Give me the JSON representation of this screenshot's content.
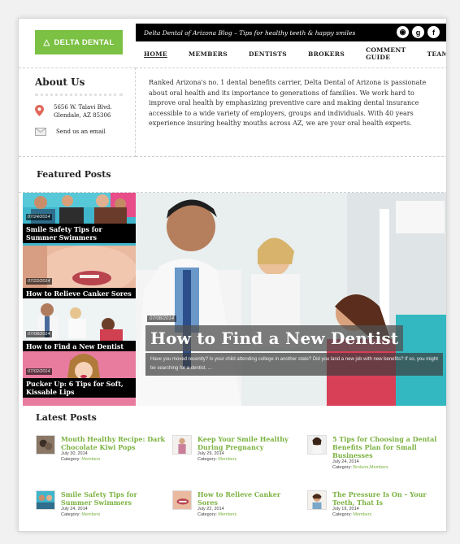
{
  "brand": {
    "logo_text": "DELTA DENTAL",
    "accent": "#7bc143"
  },
  "topbar": {
    "tagline": "Delta Dental of Arizona Blog – Tips for healthy teeth & happy smiles"
  },
  "social": [
    "rss-icon",
    "google-plus-icon",
    "facebook-icon"
  ],
  "nav": [
    "HOME",
    "MEMBERS",
    "DENTISTS",
    "BROKERS",
    "COMMENT GUIDE",
    "TEAM"
  ],
  "about": {
    "heading": "About Us",
    "address_line1": "5656 W. Talavi Blvd.",
    "address_line2": "Glendale, AZ 85306",
    "email_label": "Send us an email",
    "description": "Ranked Arizona's no. 1 dental benefits carrier, Delta Dental of Arizona is passionate about oral health and its importance to generations of families. We work hard to improve oral health by emphasizing preventive care and making dental insurance accessible to a wide variety of employers, groups and individuals. With 40 years experience insuring healthy mouths across AZ, we are your oral health experts."
  },
  "featured": {
    "heading": "Featured Posts",
    "items": [
      {
        "date": "07/24/2014",
        "title": "Smile Safety Tips for Summer Swimmers"
      },
      {
        "date": "07/22/2014",
        "title": "How to Relieve Canker Sores"
      },
      {
        "date": "07/08/2014",
        "title": "How to Find a New Dentist"
      },
      {
        "date": "07/02/2014",
        "title": "Pucker Up: 6 Tips for Soft, Kissable Lips"
      }
    ],
    "hero": {
      "date": "07/08/2014",
      "title": "How to Find a New Dentist",
      "excerpt": "Have you moved recently? Is your child attending college in another state? Did you land a new job with new benefits? If so, you might be searching for a dentist. ..."
    }
  },
  "latest": {
    "heading": "Latest Posts",
    "posts": [
      {
        "title": "Mouth Healthy Recipe: Dark Chocolate Kiwi Pops",
        "date": "July 30, 2014",
        "category_label": "Category:",
        "category": "Members"
      },
      {
        "title": "Keep Your Smile Healthy During Pregnancy",
        "date": "July 29, 2014",
        "category_label": "Category:",
        "category": "Members"
      },
      {
        "title": "5 Tips for Choosing a Dental Benefits Plan for Small Businesses",
        "date": "July 24, 2014",
        "category_label": "Category:",
        "category": "Brokers,Members"
      },
      {
        "title": "Smile Safety Tips for Summer Swimmers",
        "date": "July 24, 2014",
        "category_label": "Category:",
        "category": "Members"
      },
      {
        "title": "How to Relieve Canker Sores",
        "date": "July 22, 2014",
        "category_label": "Category:",
        "category": "Members"
      },
      {
        "title": "The Pressure Is On – Your Teeth, That Is",
        "date": "July 19, 2014",
        "category_label": "Category:",
        "category": "Members"
      }
    ]
  }
}
